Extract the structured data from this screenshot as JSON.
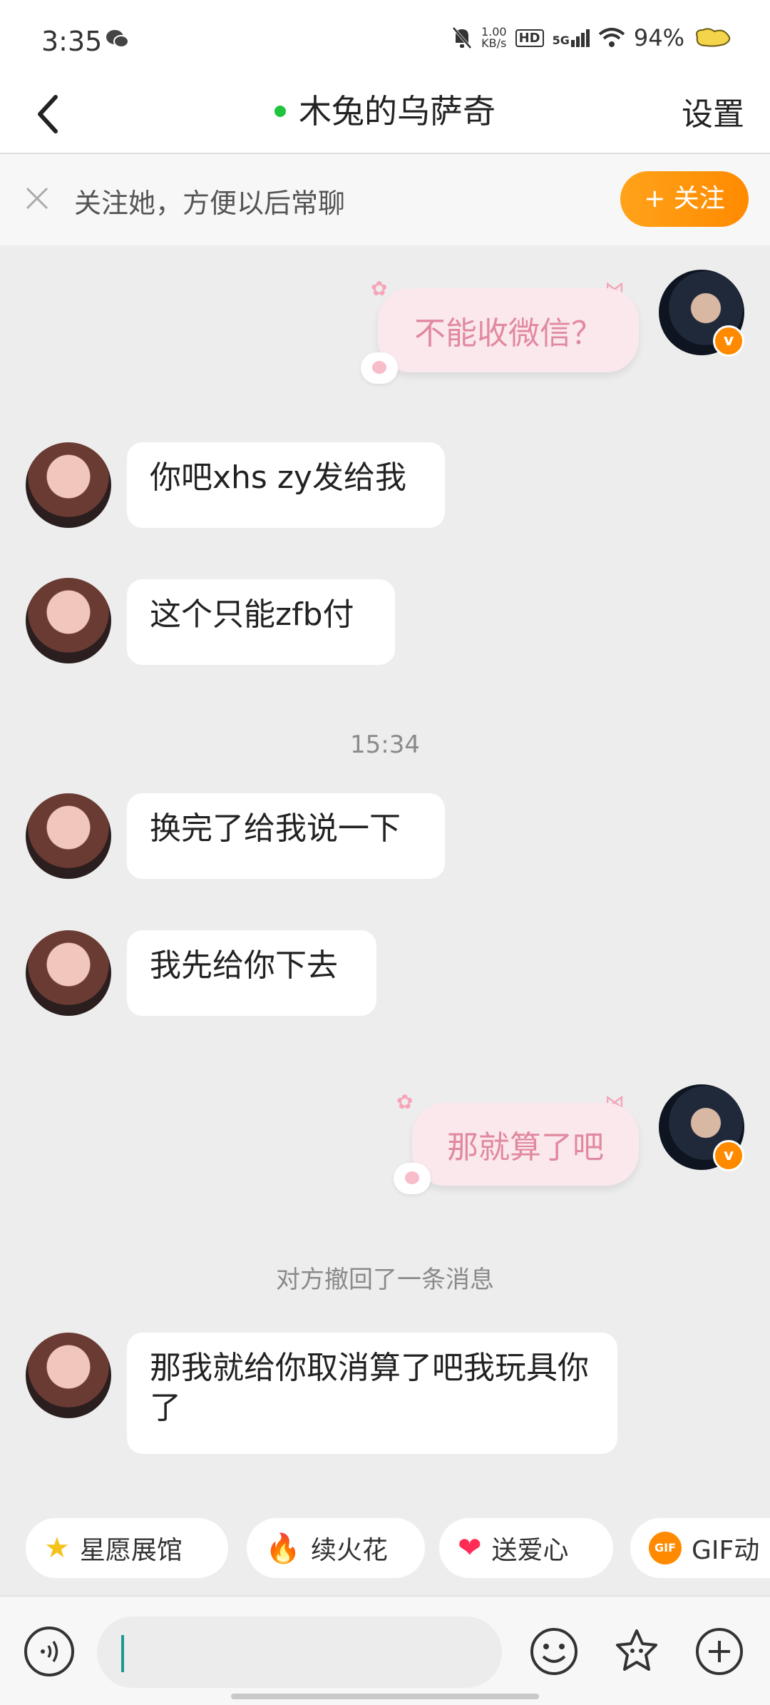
{
  "status": {
    "time": "3:35",
    "net_speed_value": "1.00",
    "net_speed_unit": "KB/s",
    "hd": "HD",
    "signal": "5G",
    "battery": "94%"
  },
  "header": {
    "title": "木兔的乌萨奇",
    "settings": "设置"
  },
  "follow_bar": {
    "text": "关注她，方便以后常聊",
    "button": "+ 关注"
  },
  "messages": {
    "m1": "不能收微信？",
    "m2": "你吧xhs zy发给我",
    "m3": "这个只能zfb付",
    "time1": "15:34",
    "m4": "换完了给我说一下",
    "m5": "我先给你下去",
    "m6": "那就算了吧",
    "recall": "对方撤回了一条消息",
    "m7": "那我就给你取消算了吧我玩具你了"
  },
  "badge": {
    "v": "v"
  },
  "quick_actions": [
    {
      "label": "星愿展馆",
      "icon": "star-icon"
    },
    {
      "label": "续火花",
      "icon": "fire-icon"
    },
    {
      "label": "送爱心",
      "icon": "heart-icon"
    },
    {
      "label": "GIF动",
      "icon": "gif-icon"
    }
  ],
  "colors": {
    "accent": "#ff8a00",
    "online": "#1fc43c",
    "pink_text": "#e189a0"
  }
}
